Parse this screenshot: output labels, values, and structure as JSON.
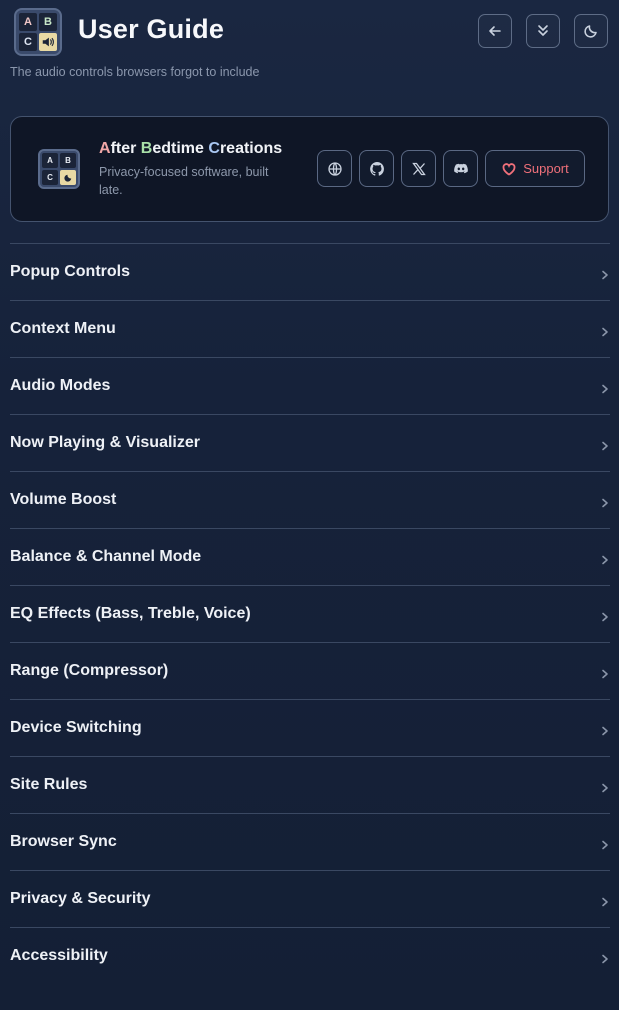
{
  "header": {
    "title": "User Guide",
    "tagline": "The audio controls browsers forgot to include",
    "logo_cells": [
      "A",
      "B",
      "C"
    ],
    "buttons": [
      {
        "icon": "arrow-left-icon"
      },
      {
        "icon": "chevrons-down-icon"
      },
      {
        "icon": "moon-icon"
      }
    ]
  },
  "brand_card": {
    "logo_cells": [
      "A",
      "B",
      "C"
    ],
    "title_parts": [
      "A",
      "fter ",
      "B",
      "edtime ",
      "C",
      "reations"
    ],
    "description": "Privacy-focused software, built late.",
    "links": [
      {
        "icon": "globe-icon"
      },
      {
        "icon": "github-icon"
      },
      {
        "icon": "x-icon"
      },
      {
        "icon": "discord-icon"
      }
    ],
    "support_label": "Support",
    "support_color": "#f0707a"
  },
  "sections": [
    {
      "label": "Popup Controls"
    },
    {
      "label": "Context Menu"
    },
    {
      "label": "Audio Modes"
    },
    {
      "label": "Now Playing & Visualizer"
    },
    {
      "label": "Volume Boost"
    },
    {
      "label": "Balance & Channel Mode"
    },
    {
      "label": "EQ Effects (Bass, Treble, Voice)"
    },
    {
      "label": "Range (Compressor)"
    },
    {
      "label": "Device Switching"
    },
    {
      "label": "Site Rules"
    },
    {
      "label": "Browser Sync"
    },
    {
      "label": "Privacy & Security"
    },
    {
      "label": "Accessibility"
    }
  ],
  "colors": {
    "background": "#16223a",
    "card_background": "#0f1626",
    "divider": "#3a4862",
    "accent_red": "#f0707a"
  }
}
